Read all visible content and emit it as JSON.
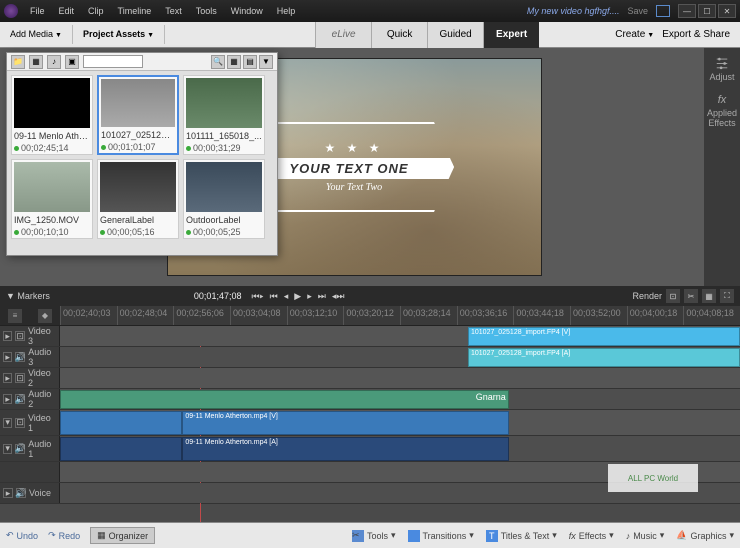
{
  "titlebar": {
    "menus": [
      "File",
      "Edit",
      "Clip",
      "Timeline",
      "Text",
      "Tools",
      "Window",
      "Help"
    ],
    "project_name": "My new video hgfhgf....",
    "save_label": "Save"
  },
  "toolbar": {
    "add_media": "Add Media",
    "project_assets": "Project Assets",
    "tabs": [
      {
        "label": "eLive",
        "active": false
      },
      {
        "label": "Quick",
        "active": false
      },
      {
        "label": "Guided",
        "active": false
      },
      {
        "label": "Expert",
        "active": true
      }
    ],
    "create": "Create",
    "export": "Export & Share"
  },
  "side_panel": {
    "adjust": "Adjust",
    "fx": "fx",
    "applied": "Applied Effects"
  },
  "preview": {
    "title_main": "YOUR TEXT ONE",
    "title_sub": "Your Text Two"
  },
  "assets": {
    "items": [
      {
        "name": "09-11 Menlo Athe...",
        "duration": "00;02;45;14"
      },
      {
        "name": "101027_025128_...",
        "duration": "00;01;01;07"
      },
      {
        "name": "101111_165018_...",
        "duration": "00;00;31;29"
      },
      {
        "name": "IMG_1250.MOV",
        "duration": "00;00;10;10"
      },
      {
        "name": "GeneralLabel",
        "duration": "00;00;05;16"
      },
      {
        "name": "OutdoorLabel",
        "duration": "00;00;05;25"
      }
    ]
  },
  "timeline_header": {
    "markers": "Markers",
    "current_time": "00;01;47;08",
    "render": "Render"
  },
  "ruler": {
    "ticks": [
      "00;02;40;03",
      "00;02;48;04",
      "00;02;56;06",
      "00;03;04;08",
      "00;03;12;10",
      "00;03;20;12",
      "00;03;28;14",
      "00;03;36;16",
      "00;03;44;18",
      "00;03;52;00",
      "00;04;00;18",
      "00;04;08;18"
    ]
  },
  "tracks": {
    "items": [
      {
        "name": "Video 3"
      },
      {
        "name": "Audio 3"
      },
      {
        "name": "Video 2"
      },
      {
        "name": "Audio 2"
      },
      {
        "name": "Video 1"
      },
      {
        "name": "Audio 1"
      },
      {
        "name": ""
      },
      {
        "name": "Voice"
      }
    ],
    "clips": {
      "v3": "101027_025128_import.FP4 [V]",
      "a3": "101027_025128_import.FP4 [A]",
      "a2_green": "Gnarna",
      "v1": "09-11 Menlo Atherton.mp4 [V]",
      "a1": "09-11 Menlo Atherton.mp4 [A]"
    }
  },
  "bottom": {
    "undo": "Undo",
    "redo": "Redo",
    "organizer": "Organizer",
    "tools": "Tools",
    "transitions": "Transitions",
    "titles": "Titles & Text",
    "effects": "Effects",
    "music": "Music",
    "graphics": "Graphics"
  },
  "watermark": "ALL PC World"
}
